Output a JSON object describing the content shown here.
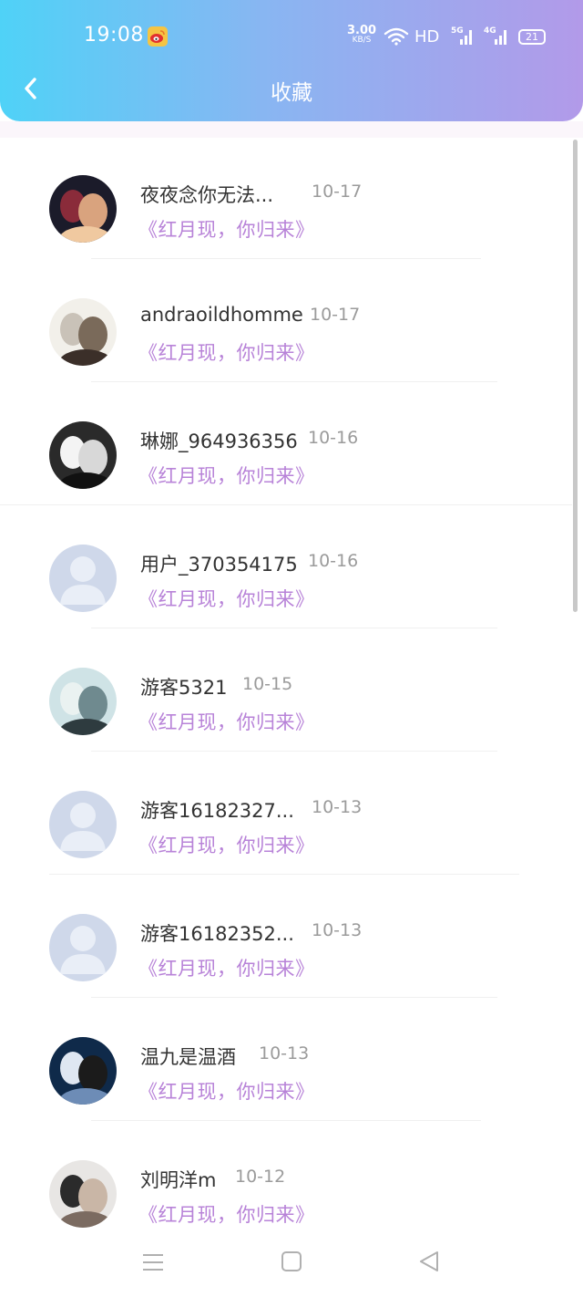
{
  "status": {
    "time": "19:08",
    "speed_value": "3.00",
    "speed_unit": "KB/S",
    "hd": "HD",
    "net1": "5G",
    "net2": "4G",
    "battery": "21"
  },
  "header": {
    "title": "收藏"
  },
  "items": [
    {
      "name": "夜夜念你无法...",
      "date": "10-17",
      "book": "《红月现，你归来》",
      "avatar": "photo-couple"
    },
    {
      "name": "andraoildhomme",
      "date": "10-17",
      "book": "《红月现，你归来》",
      "avatar": "photo-cat"
    },
    {
      "name": "琳娜_964936356",
      "date": "10-16",
      "book": "《红月现，你归来》",
      "avatar": "photo-dog"
    },
    {
      "name": "用户_370354175",
      "date": "10-16",
      "book": "《红月现，你归来》",
      "avatar": "default"
    },
    {
      "name": "游客5321",
      "date": "10-15",
      "book": "《红月现，你归来》",
      "avatar": "photo-poster"
    },
    {
      "name": "游客16182327...",
      "date": "10-13",
      "book": "《红月现，你归来》",
      "avatar": "default"
    },
    {
      "name": "游客16182352...",
      "date": "10-13",
      "book": "《红月现，你归来》",
      "avatar": "default"
    },
    {
      "name": "温九是温酒",
      "date": "10-13",
      "book": "《红月现，你归来》",
      "avatar": "photo-costume"
    },
    {
      "name": "刘明洋m",
      "date": "10-12",
      "book": "《红月现，你归来》",
      "avatar": "photo-pair"
    }
  ],
  "colors": {
    "header_gradient_start": "#4fd2f7",
    "header_gradient_end": "#b29ae9",
    "book_title": "#b883d8",
    "date": "#9b9b9b"
  }
}
